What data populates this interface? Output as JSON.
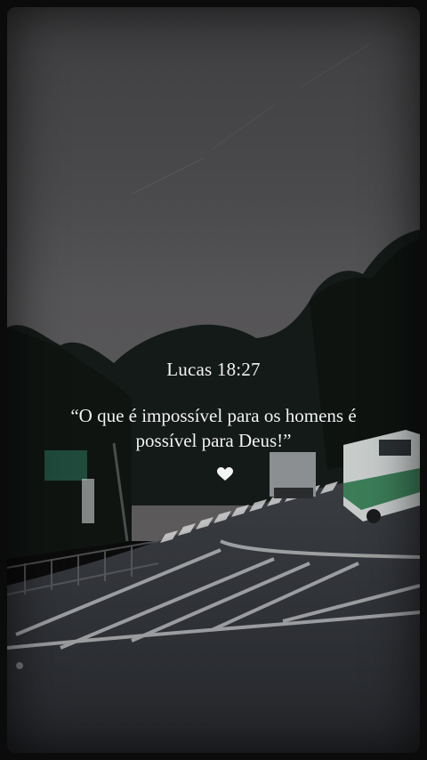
{
  "verse": {
    "reference": "Lucas 18:27",
    "quote": "“O que é impossível para os homens é possível para Deus!”"
  },
  "icons": {
    "heart": "heart-icon"
  },
  "colors": {
    "text": "#f2f2f2",
    "sky": "#4b4b4d",
    "road": "#2f3236",
    "trees": "#141a17"
  }
}
